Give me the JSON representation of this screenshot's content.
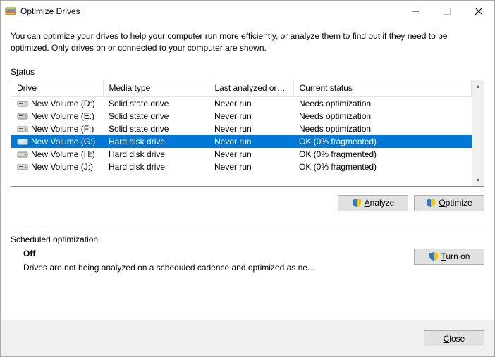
{
  "window": {
    "title": "Optimize Drives"
  },
  "intro": "You can optimize your drives to help your computer run more efficiently, or analyze them to find out if they need to be optimized. Only drives on or connected to your computer are shown.",
  "status_label": "Status",
  "columns": {
    "drive": "Drive",
    "media": "Media type",
    "last": "Last analyzed or o...",
    "status": "Current status"
  },
  "drives": [
    {
      "name": "New Volume (D:)",
      "media": "Solid state drive",
      "last": "Never run",
      "status": "Needs optimization",
      "selected": false
    },
    {
      "name": "New Volume (E:)",
      "media": "Solid state drive",
      "last": "Never run",
      "status": "Needs optimization",
      "selected": false
    },
    {
      "name": "New Volume (F:)",
      "media": "Solid state drive",
      "last": "Never run",
      "status": "Needs optimization",
      "selected": false
    },
    {
      "name": "New Volume (G:)",
      "media": "Hard disk drive",
      "last": "Never run",
      "status": "OK (0% fragmented)",
      "selected": true
    },
    {
      "name": "New Volume (H:)",
      "media": "Hard disk drive",
      "last": "Never run",
      "status": "OK (0% fragmented)",
      "selected": false
    },
    {
      "name": "New Volume (J:)",
      "media": "Hard disk drive",
      "last": "Never run",
      "status": "OK (0% fragmented)",
      "selected": false
    }
  ],
  "buttons": {
    "analyze": "Analyze",
    "optimize": "Optimize",
    "turn_on": "Turn on",
    "close": "Close"
  },
  "scheduled": {
    "label": "Scheduled optimization",
    "state": "Off",
    "description": "Drives are not being analyzed on a scheduled cadence and optimized as ne..."
  }
}
